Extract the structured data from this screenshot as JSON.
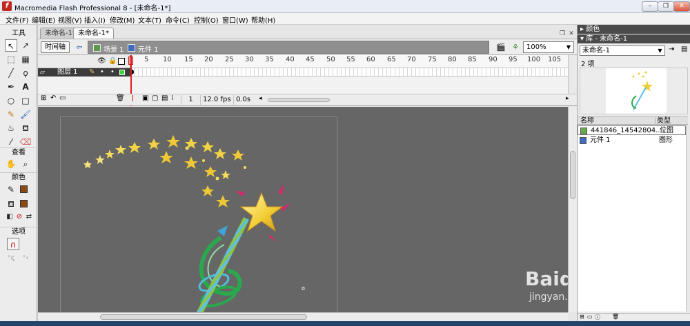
{
  "window": {
    "title": "Macromedia Flash Professional 8 - [未命名-1*]",
    "logo": "f",
    "minimize": "–",
    "restore": "❐",
    "close": "✕"
  },
  "menu": [
    "文件(F)",
    "编辑(E)",
    "视图(V)",
    "插入(I)",
    "修改(M)",
    "文本(T)",
    "命令(C)",
    "控制(O)",
    "窗口(W)",
    "帮助(H)"
  ],
  "tools": {
    "header": "工具",
    "view_label": "查看",
    "colors_label": "颜色",
    "options_label": "选项",
    "stroke_color": "#8b4a12",
    "fill_color": "#8b4a12"
  },
  "document": {
    "tabs": [
      "未命名-1*",
      "未命名-1*"
    ],
    "active_tab": 1,
    "timeline_button": "时间轴",
    "scene": "场景 1",
    "symbol": "元件 1",
    "zoom": "100%"
  },
  "timeline": {
    "ticks": [
      "5",
      "10",
      "15",
      "20",
      "25",
      "30",
      "35",
      "40",
      "45",
      "50",
      "55",
      "60",
      "65",
      "70",
      "75",
      "80",
      "85",
      "90",
      "95",
      "100",
      "105"
    ],
    "layer_name": "图层 1",
    "current_frame": "1",
    "fps": "12.0 fps",
    "time": "0.0s"
  },
  "panels": {
    "color_title": "颜色",
    "library_title": "库 - 未命名-1",
    "library_select": "未命名-1",
    "item_count": "2 项",
    "col_name": "名称",
    "col_type": "类型",
    "items": [
      {
        "name": "441846_14542804...",
        "type": "位图"
      },
      {
        "name": "元件 1",
        "type": "图形"
      }
    ]
  },
  "watermark": {
    "brand": "Baidu经验",
    "url": "jingyan.baidu.com"
  }
}
